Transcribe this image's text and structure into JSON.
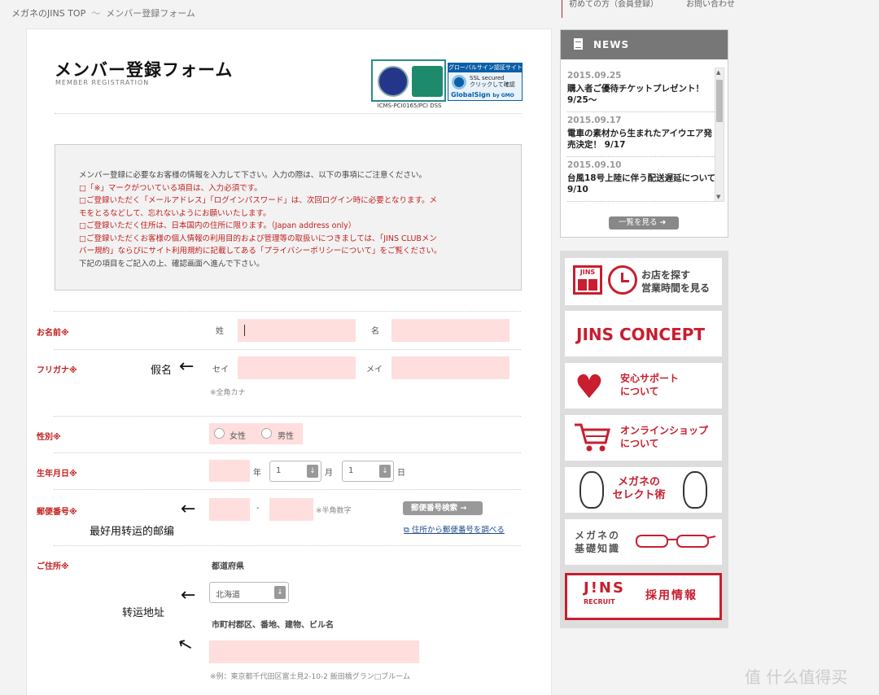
{
  "breadcrumb": {
    "home": "メガネのJINS TOP",
    "sep": "〜",
    "current": "メンバー登録フォーム"
  },
  "toplinks": {
    "first_time": "初めての方（会員登録）",
    "contact": "お問い合わせ"
  },
  "header": {
    "title": "メンバー登録フォーム",
    "subtitle": "MEMBER REGISTRATION",
    "seal1_caption": "ICMS-PCI0165/PCI DSS",
    "seal2_band": "グローバルサイン認証サイト",
    "seal2_text1": "SSL secured",
    "seal2_text2": "クリックして確認",
    "seal2_brand": "GlobalSign",
    "seal2_by": "by GMO"
  },
  "notice": {
    "line1": "メンバー登録に必要なお客様の情報を入力して下さい。入力の際は、以下の事項にご注意ください。",
    "line2": "□「※」マークがついている項目は、入力必須です。",
    "line3": "□ご登録いただく「メールアドレス」「ログインパスワード」は、次回ログイン時に必要となります。メ",
    "line4": "モをとるなどして、忘れないようにお願いいたします。",
    "line5": "□ご登録いただく住所は、日本国内の住所に限ります。（Japan address only）",
    "line6": "□ご登録いただくお客様の個人情報の利用目的および管理等の取扱いにつきましては、「JINS CLUBメン",
    "line7": "バー規約」ならびにサイト利用規約に記載してある「プライバシーポリシーについて」をご覧ください。",
    "line8": "下記の項目をご記入の上、確認画面へ進んで下さい。"
  },
  "form": {
    "name_label": "お名前※",
    "sei": "姓",
    "mei": "名",
    "kana_label": "フリガナ※",
    "sei_kana": "セイ",
    "mei_kana": "メイ",
    "kana_note": "※全角カナ",
    "gender_label": "性別※",
    "female": "女性",
    "male": "男性",
    "birth_label": "生年月日※",
    "year": "年",
    "month_value": "1",
    "month": "月",
    "day_value": "1",
    "day": "日",
    "zip_label": "郵便番号※",
    "zip_dash": "-",
    "zip_note": "※半角数字",
    "zip_search_button": "郵便番号検索",
    "zip_lookup_link": "住所から郵便番号を調べる",
    "address_label": "ご住所※",
    "pref_label": "都道府県",
    "pref_value": "北海道",
    "city_label": "市町村郡区、番地、建物、ビル名",
    "address_example": "※例：東京都千代田区富士見2-10-2 飯田橋グラン□ブルーム"
  },
  "annotations": {
    "kana": "假名",
    "zip": "最好用转运的邮编",
    "address": "转运地址",
    "arrow": "←"
  },
  "news": {
    "title": "NEWS",
    "items": [
      {
        "date": "2015.09.25",
        "text": "購入者ご優待チケットプレゼント！ 9/25〜"
      },
      {
        "date": "2015.09.17",
        "text": "電車の素材から生まれたアイウエア発売決定！ 9/17"
      },
      {
        "date": "2015.09.10",
        "text": "台風18号上陸に伴う配送遅延について 9/10"
      }
    ],
    "more_button": "一覧を見る"
  },
  "banners": {
    "store_logo": "JINS",
    "store_line1": "お店を探す",
    "store_line2": "営業時間を見る",
    "concept": "JINS CONCEPT",
    "support_line1": "安心サポート",
    "support_line2": "について",
    "shop_line1": "オンラインショップ",
    "shop_line2": "について",
    "select_line1": "メガネの",
    "select_line2": "セレクト術",
    "basics_line1": "メガネの",
    "basics_line2": "基礎知識",
    "recruit_logo": "J!NS",
    "recruit_sub": "RECRUIT",
    "recruit_text": "採用情報"
  },
  "watermark": "值 什么值得买",
  "colors": {
    "brand_red": "#c81e2f",
    "field_pink": "#ffdede",
    "news_gray": "#777777"
  }
}
